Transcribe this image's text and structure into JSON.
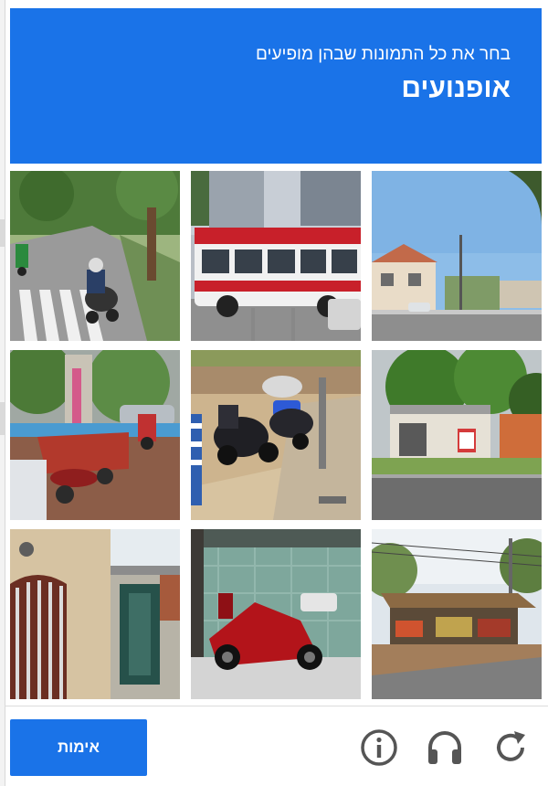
{
  "challenge": {
    "instruction": "בחר את כל התמונות שבהן מופיעים",
    "target_object": "אופנועים"
  },
  "tiles": [
    {
      "scene": "street-crosswalk-motorcyclists"
    },
    {
      "scene": "city-bus"
    },
    {
      "scene": "street-houses-sky"
    },
    {
      "scene": "parked-motorcycles-trailer"
    },
    {
      "scene": "scooters-sidewalk"
    },
    {
      "scene": "roadside-trees-shop"
    },
    {
      "scene": "building-wall-door"
    },
    {
      "scene": "red-scooter-wall"
    },
    {
      "scene": "market-stall"
    }
  ],
  "footer": {
    "verify_label": "אימות",
    "icons": [
      "reload-icon",
      "audio-icon",
      "info-icon"
    ]
  },
  "colors": {
    "accent": "#1a73e8",
    "icon": "#555555"
  }
}
